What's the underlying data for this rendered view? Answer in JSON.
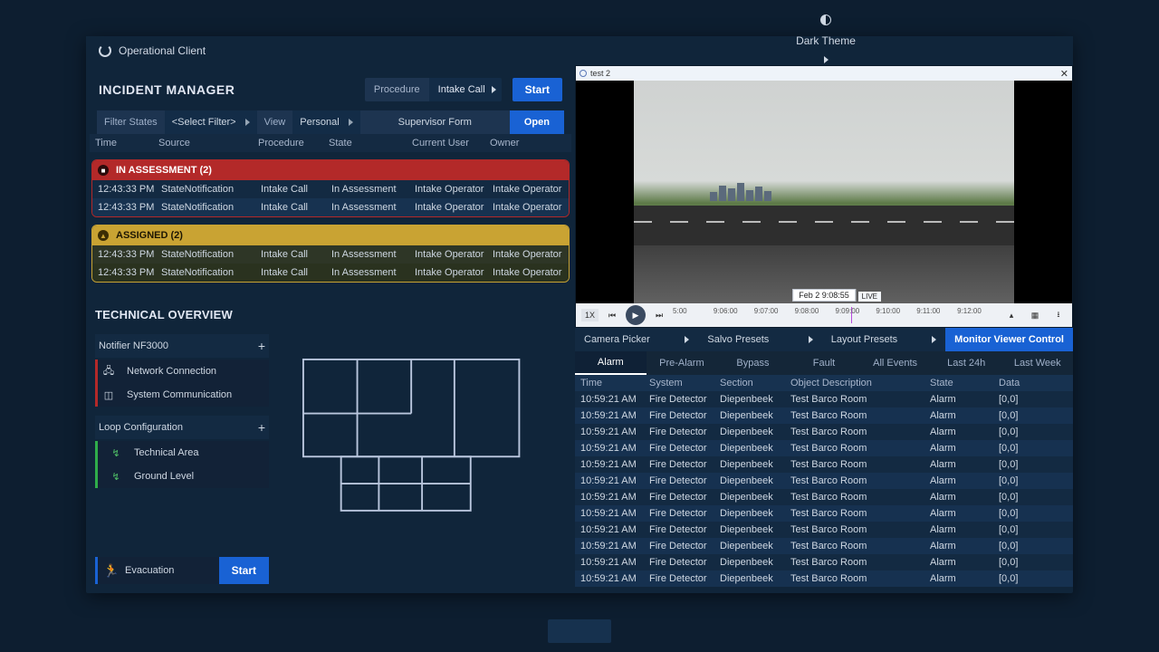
{
  "titlebar": {
    "app_name": "Operational Client",
    "theme_icon_tooltip": "theme",
    "theme_label": "Dark Theme"
  },
  "window_controls": {
    "minimize": "─",
    "maximize": "▢",
    "close": "✕"
  },
  "incident": {
    "heading": "INCIDENT MANAGER",
    "procedure_label": "Procedure",
    "procedure_value": "Intake Call",
    "start_label": "Start",
    "filter_states_label": "Filter States",
    "filter_value": "<Select Filter>",
    "view_label": "View",
    "view_value": "Personal",
    "supervisor_form": "Supervisor Form",
    "open_label": "Open",
    "columns": [
      "Time",
      "Source",
      "Procedure",
      "State",
      "Current User",
      "Owner"
    ],
    "groups": [
      {
        "style": "red",
        "title": "IN ASSESSMENT (2)",
        "rows": [
          {
            "time": "12:43:33 PM",
            "source": "StateNotification",
            "procedure": "Intake Call",
            "state": "In Assessment",
            "current": "Intake Operator",
            "owner": "Intake Operator"
          },
          {
            "time": "12:43:33 PM",
            "source": "StateNotification",
            "procedure": "Intake Call",
            "state": "In Assessment",
            "current": "Intake Operator",
            "owner": "Intake Operator"
          }
        ]
      },
      {
        "style": "amber",
        "title": "ASSIGNED (2)",
        "rows": [
          {
            "time": "12:43:33 PM",
            "source": "StateNotification",
            "procedure": "Intake Call",
            "state": "In Assessment",
            "current": "Intake Operator",
            "owner": "Intake Operator"
          },
          {
            "time": "12:43:33 PM",
            "source": "StateNotification",
            "procedure": "Intake Call",
            "state": "In Assessment",
            "current": "Intake Operator",
            "owner": "Intake Operator"
          }
        ]
      }
    ]
  },
  "tech": {
    "heading": "TECHNICAL OVERVIEW",
    "panel_label": "Notifier NF3000",
    "items_err": [
      {
        "icon": "🖧",
        "label": "Network Connection"
      },
      {
        "icon": "◫",
        "label": "System Communication"
      }
    ],
    "loop_label": "Loop Configuration",
    "items_ok": [
      {
        "icon": "↯",
        "label": "Technical Area"
      },
      {
        "icon": "↯",
        "label": "Ground Level"
      }
    ],
    "evacuation_label": "Evacuation",
    "evacuation_start": "Start"
  },
  "video": {
    "tab_name": "test 2",
    "timestamp": "Feb 2 9:08:55",
    "live": "LIVE",
    "speed": "1X",
    "timeline_ticks": [
      "5:00",
      "9:06:00",
      "9:07:00",
      "9:08:00",
      "9:09:00",
      "9:10:00",
      "9:11:00",
      "9:12:00"
    ]
  },
  "viewer_bar": {
    "camera_picker": "Camera Picker",
    "salvo": "Salvo Presets",
    "layout": "Layout Presets",
    "control": "Monitor Viewer Control"
  },
  "event_tabs": [
    "Alarm",
    "Pre-Alarm",
    "Bypass",
    "Fault",
    "All Events",
    "Last 24h",
    "Last Week"
  ],
  "event_active": 0,
  "events": {
    "columns": [
      "Time",
      "System",
      "Section",
      "Object Description",
      "State",
      "Data"
    ],
    "rows": [
      {
        "time": "10:59:21 AM",
        "system": "Fire Detector",
        "section": "Diepenbeek",
        "obj": "Test Barco Room",
        "state": "Alarm",
        "data": "[0,0]"
      },
      {
        "time": "10:59:21 AM",
        "system": "Fire Detector",
        "section": "Diepenbeek",
        "obj": "Test Barco Room",
        "state": "Alarm",
        "data": "[0,0]"
      },
      {
        "time": "10:59:21 AM",
        "system": "Fire Detector",
        "section": "Diepenbeek",
        "obj": "Test Barco Room",
        "state": "Alarm",
        "data": "[0,0]"
      },
      {
        "time": "10:59:21 AM",
        "system": "Fire Detector",
        "section": "Diepenbeek",
        "obj": "Test Barco Room",
        "state": "Alarm",
        "data": "[0,0]"
      },
      {
        "time": "10:59:21 AM",
        "system": "Fire Detector",
        "section": "Diepenbeek",
        "obj": "Test Barco Room",
        "state": "Alarm",
        "data": "[0,0]"
      },
      {
        "time": "10:59:21 AM",
        "system": "Fire Detector",
        "section": "Diepenbeek",
        "obj": "Test Barco Room",
        "state": "Alarm",
        "data": "[0,0]"
      },
      {
        "time": "10:59:21 AM",
        "system": "Fire Detector",
        "section": "Diepenbeek",
        "obj": "Test Barco Room",
        "state": "Alarm",
        "data": "[0,0]"
      },
      {
        "time": "10:59:21 AM",
        "system": "Fire Detector",
        "section": "Diepenbeek",
        "obj": "Test Barco Room",
        "state": "Alarm",
        "data": "[0,0]"
      },
      {
        "time": "10:59:21 AM",
        "system": "Fire Detector",
        "section": "Diepenbeek",
        "obj": "Test Barco Room",
        "state": "Alarm",
        "data": "[0,0]"
      },
      {
        "time": "10:59:21 AM",
        "system": "Fire Detector",
        "section": "Diepenbeek",
        "obj": "Test Barco Room",
        "state": "Alarm",
        "data": "[0,0]"
      },
      {
        "time": "10:59:21 AM",
        "system": "Fire Detector",
        "section": "Diepenbeek",
        "obj": "Test Barco Room",
        "state": "Alarm",
        "data": "[0,0]"
      },
      {
        "time": "10:59:21 AM",
        "system": "Fire Detector",
        "section": "Diepenbeek",
        "obj": "Test Barco Room",
        "state": "Alarm",
        "data": "[0,0]"
      }
    ]
  }
}
